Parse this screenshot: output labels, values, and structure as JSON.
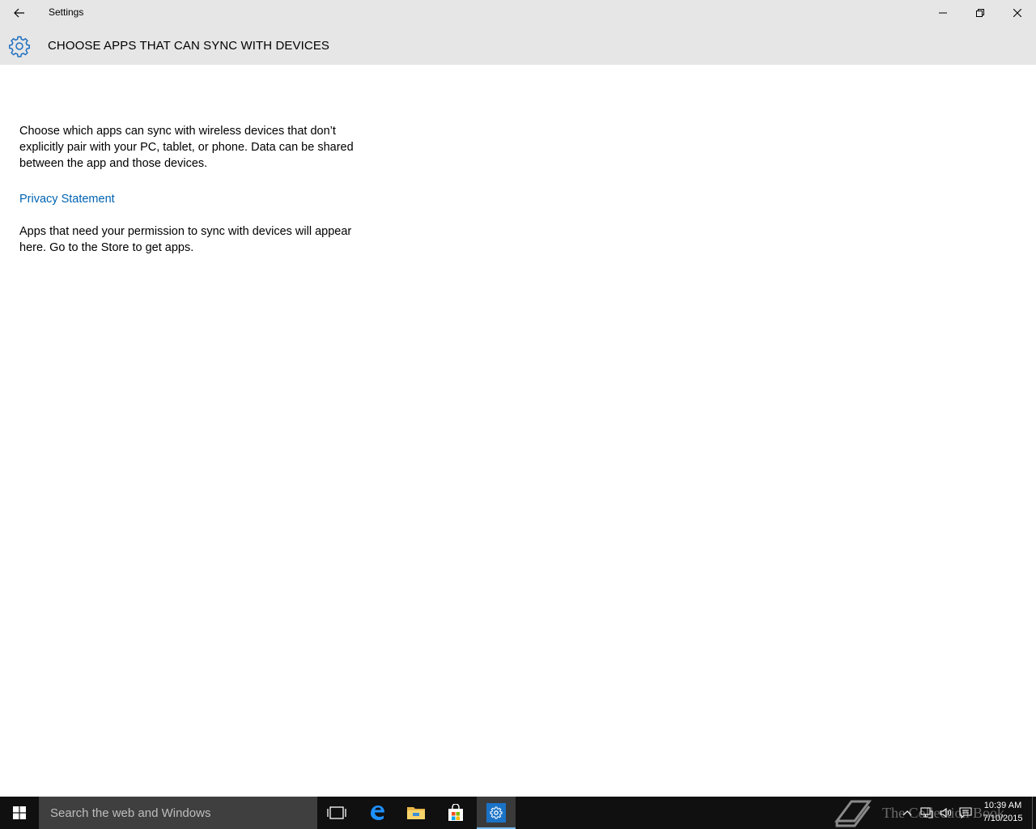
{
  "window": {
    "title": "Settings",
    "controls": {
      "back": "back-arrow-icon",
      "minimize": "minimize-icon",
      "restore": "restore-icon",
      "close": "close-icon"
    }
  },
  "header": {
    "icon": "gear-icon",
    "title": "CHOOSE APPS THAT CAN SYNC WITH DEVICES"
  },
  "content": {
    "description": "Choose which apps can sync with wireless devices that don’t explicitly pair with your PC, tablet, or phone. Data can be shared between the app and those devices.",
    "privacy_link": "Privacy Statement",
    "note": "Apps that need your permission to sync with devices will appear here. Go to the Store to get apps."
  },
  "taskbar": {
    "search_placeholder": "Search the web and Windows",
    "pinned": [
      "task-view-icon",
      "edge-icon",
      "file-explorer-icon",
      "store-icon",
      "settings-icon"
    ],
    "watermark": "The Collection Book",
    "time": "10:39 AM",
    "date": "7/10/2015"
  },
  "colors": {
    "accent": "#0063b1",
    "header_bg": "#e6e6e6",
    "taskbar_bg": "#101010",
    "search_bg": "#3f3f3f"
  }
}
